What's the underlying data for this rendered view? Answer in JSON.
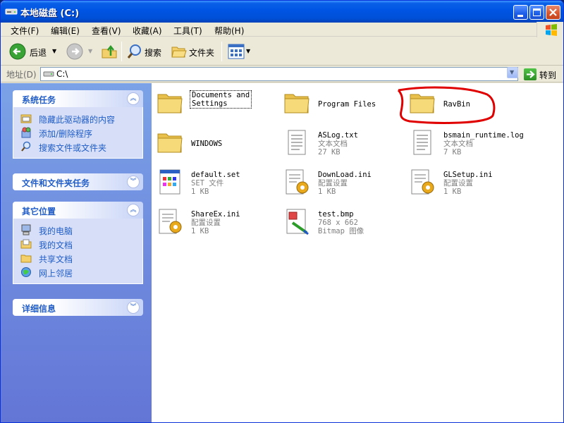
{
  "window": {
    "title": "本地磁盘 (C:)"
  },
  "menu": {
    "items": [
      "文件(F)",
      "编辑(E)",
      "查看(V)",
      "收藏(A)",
      "工具(T)",
      "帮助(H)"
    ]
  },
  "toolbar": {
    "back_label": "后退",
    "search_label": "搜索",
    "folders_label": "文件夹"
  },
  "address": {
    "label": "地址(D)",
    "value": "C:\\",
    "go_label": "转到"
  },
  "panes": {
    "system_tasks": {
      "title": "系统任务",
      "links": [
        "隐藏此驱动器的内容",
        "添加/删除程序",
        "搜索文件或文件夹"
      ]
    },
    "file_tasks": {
      "title": "文件和文件夹任务"
    },
    "other_places": {
      "title": "其它位置",
      "links": [
        "我的电脑",
        "我的文档",
        "共享文档",
        "网上邻居"
      ]
    },
    "details": {
      "title": "详细信息"
    }
  },
  "files": [
    {
      "name_line1": "Documents and",
      "name_line2": "Settings",
      "kind": "folder"
    },
    {
      "name": "Program Files",
      "kind": "folder"
    },
    {
      "name": "RavBin",
      "kind": "folder"
    },
    {
      "name": "WINDOWS",
      "kind": "folder"
    },
    {
      "name": "ASLog.txt",
      "type": "文本文档",
      "size": "27 KB",
      "kind": "text"
    },
    {
      "name": "bsmain_runtime.log",
      "type": "文本文档",
      "size": "7 KB",
      "kind": "text"
    },
    {
      "name": "default.set",
      "type": "SET 文件",
      "size": "1 KB",
      "kind": "set"
    },
    {
      "name": "DownLoad.ini",
      "type": "配置设置",
      "size": "1 KB",
      "kind": "ini"
    },
    {
      "name": "GLSetup.ini",
      "type": "配置设置",
      "size": "1 KB",
      "kind": "ini"
    },
    {
      "name": "ShareEx.ini",
      "type": "配置设置",
      "size": "1 KB",
      "kind": "ini"
    },
    {
      "name": "test.bmp",
      "type": "768 x 662",
      "size": "Bitmap 图像",
      "kind": "bmp"
    }
  ],
  "colors": {
    "title_blue": "#0054e3",
    "taskpane_blue": "#6375d6",
    "link_blue": "#215dc6",
    "annotation_red": "#e00000"
  }
}
